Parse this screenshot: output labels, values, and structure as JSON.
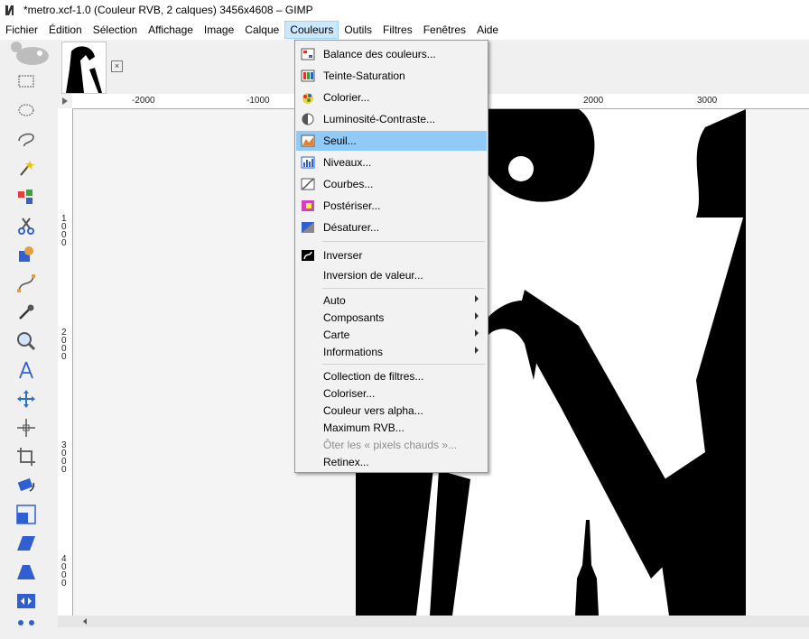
{
  "window": {
    "title": "*metro.xcf-1.0 (Couleur RVB, 2 calques) 3456x4608 – GIMP"
  },
  "menubar": {
    "items": [
      "Fichier",
      "Édition",
      "Sélection",
      "Affichage",
      "Image",
      "Calque",
      "Couleurs",
      "Outils",
      "Filtres",
      "Fenêtres",
      "Aide"
    ],
    "open": "Couleurs"
  },
  "ruler": {
    "top_labels": [
      "-2000",
      "-1000",
      "2000",
      "3000"
    ],
    "left_labels": [
      "1000",
      "2000",
      "3000",
      "4000"
    ]
  },
  "colors_menu": {
    "items": [
      {
        "label": "Balance des couleurs...",
        "icon": "color-balance-icon"
      },
      {
        "label": "Teinte-Saturation",
        "icon": "hue-saturation-icon"
      },
      {
        "label": "Colorier...",
        "icon": "colorize-icon"
      },
      {
        "label": "Luminosité-Contraste...",
        "icon": "brightness-contrast-icon"
      },
      {
        "label": "Seuil...",
        "icon": "threshold-icon",
        "highlighted": true
      },
      {
        "label": "Niveaux...",
        "icon": "levels-icon"
      },
      {
        "label": "Courbes...",
        "icon": "curves-icon"
      },
      {
        "label": "Postériser...",
        "icon": "posterize-icon"
      },
      {
        "label": "Désaturer...",
        "icon": "desaturate-icon"
      },
      {
        "label": "Inverser",
        "icon": "invert-icon"
      },
      {
        "label": "Inversion de valeur..."
      },
      {
        "label": "Auto",
        "submenu": true
      },
      {
        "label": "Composants",
        "submenu": true
      },
      {
        "label": "Carte",
        "submenu": true
      },
      {
        "label": "Informations",
        "submenu": true
      },
      {
        "label": "Collection de filtres..."
      },
      {
        "label": "Coloriser..."
      },
      {
        "label": "Couleur vers alpha..."
      },
      {
        "label": "Maximum RVB..."
      },
      {
        "label": "Ôter les « pixels chauds »...",
        "disabled": true
      },
      {
        "label": "Retinex..."
      }
    ]
  }
}
